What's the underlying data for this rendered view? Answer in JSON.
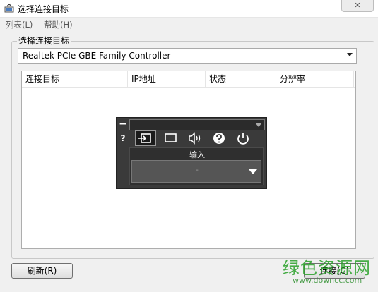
{
  "window": {
    "title": "选择连接目标",
    "close_label": "✕"
  },
  "menu": {
    "items": [
      "列表(L)",
      "帮助(H)"
    ]
  },
  "group": {
    "label": "选择连接目标"
  },
  "adapter": {
    "selected": "Realtek PCIe GBE Family Controller"
  },
  "table": {
    "columns": [
      "连接目标",
      "IP地址",
      "状态",
      "分辨率"
    ]
  },
  "osd": {
    "minus": "−",
    "help": "?",
    "icons": [
      "input-icon",
      "screen-icon",
      "volume-icon",
      "help-circle-icon",
      "power-icon"
    ],
    "input_label": "输入",
    "input_value": "-"
  },
  "buttons": {
    "refresh": "刷新(R)",
    "connect": "连接(C)"
  },
  "watermark": {
    "cn": "绿色资源网",
    "url": "www.downcc.com"
  }
}
